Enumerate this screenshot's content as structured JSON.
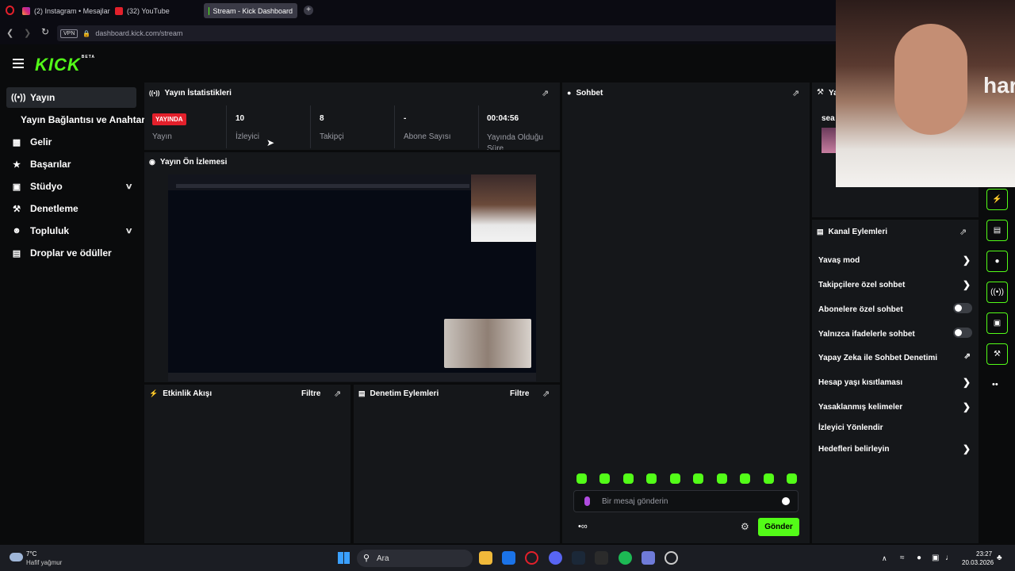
{
  "browser": {
    "tabs": [
      {
        "label": "(2) Instagram • Mesajlar"
      },
      {
        "label": "(32) YouTube"
      },
      {
        "label": "Stream - Kick Dashboard"
      }
    ],
    "new_tab": "+",
    "vpn": "VPN",
    "url": "dashboard.kick.com/stream"
  },
  "brand": {
    "logo": "KICK",
    "beta": "BETA"
  },
  "sidebar": {
    "items": [
      {
        "label": "Yayın",
        "icon": "broadcast-icon"
      },
      {
        "label": "Yayın Bağlantısı ve Anahtarı"
      },
      {
        "label": "Gelir",
        "icon": "chart-icon"
      },
      {
        "label": "Başarılar",
        "icon": "trophy-icon"
      },
      {
        "label": "Stüdyo",
        "icon": "studio-icon"
      },
      {
        "label": "Denetleme",
        "icon": "wrench-icon"
      },
      {
        "label": "Topluluk",
        "icon": "community-icon"
      },
      {
        "label": "Droplar ve ödüller",
        "icon": "drops-icon"
      }
    ]
  },
  "stats": {
    "title": "Yayın İstatistikleri",
    "live_badge": "YAYINDA",
    "items": [
      {
        "value": "",
        "label": "Yayın"
      },
      {
        "value": "10",
        "label": "İzleyici"
      },
      {
        "value": "8",
        "label": "Takipçi"
      },
      {
        "value": "-",
        "label": "Abone Sayısı"
      },
      {
        "value": "00:04:56",
        "label": "Yayında Olduğu Süre"
      }
    ]
  },
  "preview": {
    "title": "Yayın Ön İzlemesi"
  },
  "activity": {
    "title": "Etkinlik Akışı",
    "filter": "Filtre"
  },
  "moderation": {
    "title": "Denetim Eylemleri",
    "filter": "Filtre"
  },
  "chat": {
    "title": "Sohbet",
    "placeholder": "Bir mesaj gönderin",
    "send": "Gönder"
  },
  "right_panel": {
    "title_partial": "Ya",
    "search_partial": "sea"
  },
  "channel_actions": {
    "title": "Kanal Eylemleri",
    "rows": [
      {
        "label": "Yavaş mod"
      },
      {
        "label": "Takipçilere özel sohbet"
      },
      {
        "label": "Abonelere özel sohbet"
      },
      {
        "label": "Yalnızca ifadelerle sohbet"
      },
      {
        "label": "Yapay Zeka ile Sohbet Denetimi"
      },
      {
        "label": "Hesap yaşı kısıtlaması"
      },
      {
        "label": "Yasaklanmış kelimeler"
      },
      {
        "label": "İzleyici Yönlendir"
      },
      {
        "label": "Hedefleri belirleyin"
      }
    ]
  },
  "taskbar": {
    "temp": "7°C",
    "weather": "Hafif yağmur",
    "search": "Ara",
    "time": "23:27",
    "date": "20.03.2026"
  },
  "colors": {
    "accent": "#53fc18",
    "live": "#e3202b"
  }
}
